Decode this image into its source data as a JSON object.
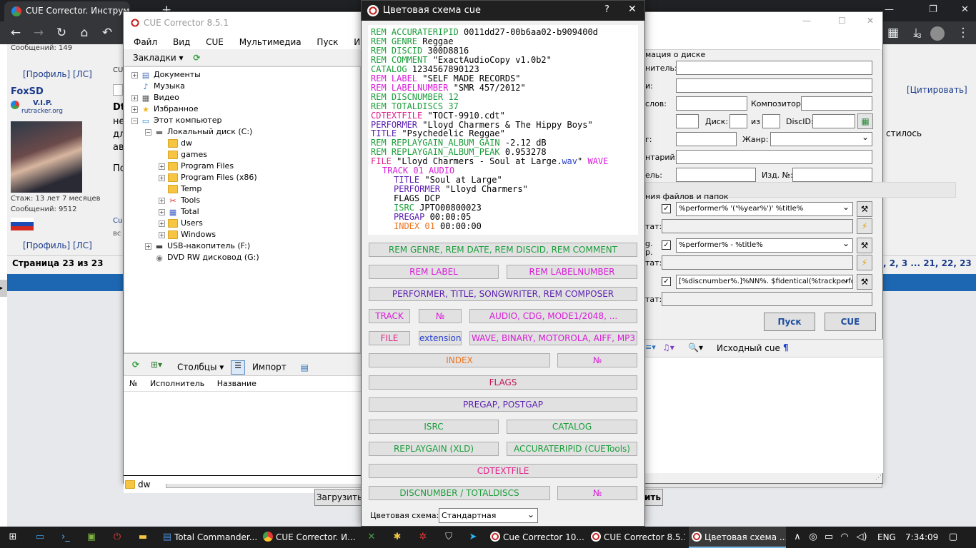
{
  "browser": {
    "tab_title": "CUE Corrector. Инструмен",
    "new_tab": "+",
    "download_count": "3"
  },
  "forum": {
    "messages_label": "Сообщений: 149",
    "profile_link": "[Профиль]",
    "pm_link": "[ЛС]",
    "username": "FoxSD",
    "rank": "V.I.P.",
    "site": "rutracker.org",
    "tenure": "Стаж: 13 лет 7 месяцев",
    "post_count": "Сообщений: 9512",
    "page_info": "Страница 23 из 23",
    "pagination": ", 2, 3 ... 21, 22, 23",
    "quote_link": "[Цитировать]",
    "fragments": [
      "Dt",
      "не",
      "дл",
      "ав",
      "По",
      "CU",
      "Cu",
      "вс"
    ],
    "text_right": "стилось"
  },
  "main_window": {
    "title": "CUE Corrector 8.5.1",
    "menu": [
      "Файл",
      "Вид",
      "CUE",
      "Мультимедиа",
      "Пуск",
      "Инструм"
    ],
    "bookmarks": "Закладки",
    "tree": [
      {
        "label": "Документы",
        "level": 0,
        "icon": "documents-icon",
        "expand": "+"
      },
      {
        "label": "Музыка",
        "level": 0,
        "icon": "music-icon",
        "expand": ""
      },
      {
        "label": "Видео",
        "level": 0,
        "icon": "video-icon",
        "expand": "+"
      },
      {
        "label": "Избранное",
        "level": 0,
        "icon": "star-icon",
        "expand": "+"
      },
      {
        "label": "Этот компьютер",
        "level": 0,
        "icon": "computer-icon",
        "expand": "−"
      },
      {
        "label": "Локальный диск (C:)",
        "level": 1,
        "icon": "drive-icon",
        "expand": "−"
      },
      {
        "label": "dw",
        "level": 2,
        "icon": "folder-icon",
        "expand": ""
      },
      {
        "label": "games",
        "level": 2,
        "icon": "folder-icon",
        "expand": ""
      },
      {
        "label": "Program Files",
        "level": 2,
        "icon": "folder-icon",
        "expand": "+"
      },
      {
        "label": "Program Files (x86)",
        "level": 2,
        "icon": "folder-icon",
        "expand": "+"
      },
      {
        "label": "Temp",
        "level": 2,
        "icon": "folder-icon",
        "expand": ""
      },
      {
        "label": "Tools",
        "level": 2,
        "icon": "tools-icon",
        "expand": "+"
      },
      {
        "label": "Total",
        "level": 2,
        "icon": "total-icon",
        "expand": "+"
      },
      {
        "label": "Users",
        "level": 2,
        "icon": "folder-icon",
        "expand": "+"
      },
      {
        "label": "Windows",
        "level": 2,
        "icon": "folder-icon",
        "expand": "+"
      },
      {
        "label": "USB-накопитель (F:)",
        "level": 1,
        "icon": "usb-icon",
        "expand": "+"
      },
      {
        "label": "DVD RW дисковод (G:)",
        "level": 1,
        "icon": "dvd-icon",
        "expand": ""
      }
    ],
    "columns_btn": "Столбцы",
    "import_btn": "Импорт",
    "list_headers": [
      "№",
      "Исполнитель",
      "Название"
    ],
    "status_folder": "dw",
    "load_btn": "Загрузить"
  },
  "right_window": {
    "disc_info_header": "мация о диске",
    "labels": {
      "performer": "нитель:",
      "album": "и:",
      "songwriter": "слов:",
      "composer": "Композитор:",
      "disc": "Диск:",
      "of": "из",
      "discid": "DiscID:",
      "date": "г:",
      "genre": "Жанр:",
      "comment": "нтарий:",
      "label": "ель:",
      "catalog": "Изд. №:",
      "rename_header": "ния файлов и папок",
      "result1": "тат:",
      "g": "g.",
      "p": "р.",
      "result2": "тат:",
      "result3": "тат:"
    },
    "patterns": [
      "%performer% '('%year%')' %title%",
      "%performer% - %title%",
      "[%discnumber%.]%NN%. $fidentical(%trackperfor"
    ],
    "start_btn": "Пуск",
    "cue_btn": "CUE",
    "source_cue": "Исходный cue",
    "pilcrow": "¶",
    "bottom_btn_fragment": "ить"
  },
  "dialog": {
    "title": "Цветовая схема cue",
    "help": "?",
    "close": "✕",
    "code_lines": [
      {
        "indent": 0,
        "parts": [
          {
            "t": "REM ACCURATERIPID",
            "c": "#1a9e3a"
          },
          {
            "t": " 0011dd27-00b6aa02-b909400d",
            "c": "#000"
          }
        ]
      },
      {
        "indent": 0,
        "parts": [
          {
            "t": "REM GENRE",
            "c": "#1a9e3a"
          },
          {
            "t": " Reggae",
            "c": "#000"
          }
        ]
      },
      {
        "indent": 0,
        "parts": [
          {
            "t": "REM DISCID",
            "c": "#1a9e3a"
          },
          {
            "t": " 300D8816",
            "c": "#000"
          }
        ]
      },
      {
        "indent": 0,
        "parts": [
          {
            "t": "REM COMMENT",
            "c": "#1a9e3a"
          },
          {
            "t": " \"ExactAudioCopy v1.0b2\"",
            "c": "#000"
          }
        ]
      },
      {
        "indent": 0,
        "parts": [
          {
            "t": "CATALOG",
            "c": "#1a9e3a"
          },
          {
            "t": " 1234567890123",
            "c": "#000"
          }
        ]
      },
      {
        "indent": 0,
        "parts": [
          {
            "t": "REM LABEL",
            "c": "#d81bd8"
          },
          {
            "t": " \"SELF MADE RECORDS\"",
            "c": "#000"
          }
        ]
      },
      {
        "indent": 0,
        "parts": [
          {
            "t": "REM LABELNUMBER",
            "c": "#d81bd8"
          },
          {
            "t": " \"SMR 457/2012\"",
            "c": "#000"
          }
        ]
      },
      {
        "indent": 0,
        "parts": [
          {
            "t": "REM DISCNUMBER 12",
            "c": "#1a9e3a"
          }
        ]
      },
      {
        "indent": 0,
        "parts": [
          {
            "t": "REM TOTALDISCS 37",
            "c": "#1a9e3a"
          }
        ]
      },
      {
        "indent": 0,
        "parts": [
          {
            "t": "CDTEXTFILE",
            "c": "#e0218a"
          },
          {
            "t": " \"TOCT-9910.cdt\"",
            "c": "#000"
          }
        ]
      },
      {
        "indent": 0,
        "parts": [
          {
            "t": "PERFORMER",
            "c": "#5b1fb0"
          },
          {
            "t": " \"Lloyd Charmers & The Hippy Boys\"",
            "c": "#000"
          }
        ]
      },
      {
        "indent": 0,
        "parts": [
          {
            "t": "TITLE",
            "c": "#5b1fb0"
          },
          {
            "t": " \"Psychedelic Reggae\"",
            "c": "#000"
          }
        ]
      },
      {
        "indent": 0,
        "parts": [
          {
            "t": "REM REPLAYGAIN_ALBUM_GAIN",
            "c": "#1a9e3a"
          },
          {
            "t": " -2.12 dB",
            "c": "#000"
          }
        ]
      },
      {
        "indent": 0,
        "parts": [
          {
            "t": "REM REPLAYGAIN_ALBUM_PEAK",
            "c": "#1a9e3a"
          },
          {
            "t": " 0.953278",
            "c": "#000"
          }
        ]
      },
      {
        "indent": 0,
        "parts": [
          {
            "t": "FILE",
            "c": "#e0218a"
          },
          {
            "t": " \"Lloyd Charmers - Soul at Large.",
            "c": "#000"
          },
          {
            "t": "wav",
            "c": "#2a40d0"
          },
          {
            "t": "\" ",
            "c": "#000"
          },
          {
            "t": "WAVE",
            "c": "#d81bd8"
          }
        ]
      },
      {
        "indent": 1,
        "parts": [
          {
            "t": "TRACK 01 AUDIO",
            "c": "#d81bd8"
          }
        ]
      },
      {
        "indent": 2,
        "parts": [
          {
            "t": "TITLE",
            "c": "#5b1fb0"
          },
          {
            "t": " \"Soul at Large\"",
            "c": "#000"
          }
        ]
      },
      {
        "indent": 2,
        "parts": [
          {
            "t": "PERFORMER",
            "c": "#5b1fb0"
          },
          {
            "t": " \"Lloyd Charmers\"",
            "c": "#000"
          }
        ]
      },
      {
        "indent": 2,
        "parts": [
          {
            "t": "FLAGS DCP",
            "c": "#000"
          }
        ]
      },
      {
        "indent": 2,
        "parts": [
          {
            "t": "ISRC",
            "c": "#1a9e3a"
          },
          {
            "t": " JPTO00800023",
            "c": "#000"
          }
        ]
      },
      {
        "indent": 2,
        "parts": [
          {
            "t": "PREGAP",
            "c": "#5b1fb0"
          },
          {
            "t": " 00:00:05",
            "c": "#000"
          }
        ]
      },
      {
        "indent": 2,
        "parts": [
          {
            "t": "INDEX 01",
            "c": "#f0731e"
          },
          {
            "t": " 00:00:00",
            "c": "#000"
          }
        ]
      }
    ],
    "buttons": [
      {
        "label": "REM GENRE, REM DATE, REM DISCID, REM COMMENT",
        "color": "#1a9e3a",
        "name": "rem-genre-button"
      },
      {
        "label": "REM LABEL",
        "color": "#d81bd8",
        "name": "rem-label-button"
      },
      {
        "label": "REM LABELNUMBER",
        "color": "#d81bd8",
        "name": "rem-labelnumber-button"
      },
      {
        "label": "PERFORMER, TITLE, SONGWRITER, REM COMPOSER",
        "color": "#5b1fb0",
        "name": "performer-title-button"
      },
      {
        "label": "TRACK",
        "color": "#d81bd8",
        "name": "track-button"
      },
      {
        "label": "№",
        "color": "#d81bd8",
        "name": "track-number-button"
      },
      {
        "label": "AUDIO, CDG, MODE1/2048, ...",
        "color": "#d81bd8",
        "name": "track-type-button"
      },
      {
        "label": "FILE",
        "color": "#e0218a",
        "name": "file-button"
      },
      {
        "label": "extension",
        "color": "#2a40d0",
        "name": "extension-button"
      },
      {
        "label": "WAVE, BINARY, MOTOROLA, AIFF, MP3",
        "color": "#d81bd8",
        "name": "file-type-button"
      },
      {
        "label": "INDEX",
        "color": "#f0731e",
        "name": "index-button"
      },
      {
        "label": "№",
        "color": "#d81bd8",
        "name": "index-number-button"
      },
      {
        "label": "FLAGS",
        "color": "#c2185b",
        "name": "flags-button"
      },
      {
        "label": "PREGAP, POSTGAP",
        "color": "#5b1fb0",
        "name": "pregap-button"
      },
      {
        "label": "ISRC",
        "color": "#1a9e3a",
        "name": "isrc-button"
      },
      {
        "label": "CATALOG",
        "color": "#1a9e3a",
        "name": "catalog-button"
      },
      {
        "label": "REPLAYGAIN (XLD)",
        "color": "#1a9e3a",
        "name": "replaygain-button"
      },
      {
        "label": "ACCURATERIPID (CUETools)",
        "color": "#1a9e3a",
        "name": "accurateripid-button"
      },
      {
        "label": "CDTEXTFILE",
        "color": "#e0218a",
        "name": "cdtextfile-button"
      },
      {
        "label": "DISCNUMBER / TOTALDISCS",
        "color": "#1a9e3a",
        "name": "discnumber-button"
      },
      {
        "label": "№",
        "color": "#d81bd8",
        "name": "disc-number-button"
      }
    ],
    "scheme_label": "Цветовая схема:",
    "scheme_value": "Стандартная"
  },
  "taskbar": {
    "items": [
      {
        "label": "Total Commander...",
        "icon": "total-commander-icon"
      },
      {
        "label": "CUE Corrector. И...",
        "icon": "chrome-icon"
      },
      {
        "label": "Cue Corrector 10....",
        "icon": "cue-corrector-icon"
      },
      {
        "label": "CUE Corrector 8.5.1",
        "icon": "cue-corrector-icon"
      },
      {
        "label": "Цветовая схема ...",
        "icon": "cue-corrector-icon"
      }
    ],
    "lang": "ENG",
    "time": "7:34:09"
  }
}
